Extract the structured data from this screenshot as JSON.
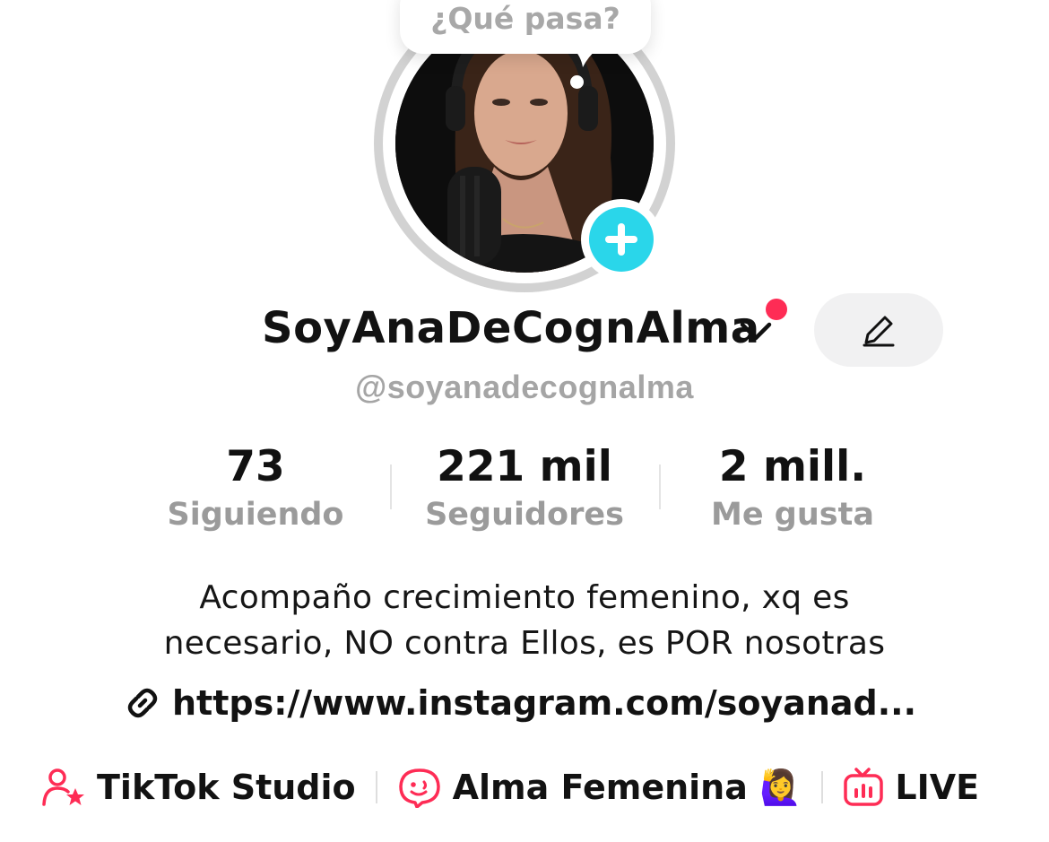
{
  "bubble": {
    "text": "¿Qué pasa?"
  },
  "profile": {
    "display_name": "SoyAnaDeCognAlma",
    "username": "@soyanadecognalma"
  },
  "stats": [
    {
      "value": "73",
      "label": "Siguiendo"
    },
    {
      "value": "221 mil",
      "label": "Seguidores"
    },
    {
      "value": "2 mill.",
      "label": "Me gusta"
    }
  ],
  "bio": {
    "line1": "Acompaño crecimiento femenino, xq es",
    "line2": "necesario, NO contra Ellos, es POR nosotras"
  },
  "link": {
    "text": "https://www.instagram.com/soyanad...",
    "icon": "link-icon"
  },
  "bottom_links": [
    {
      "label": "TikTok Studio",
      "icon": "creator-studio-icon"
    },
    {
      "label": "Alma Femenina 🙋‍♀️",
      "icon": "chat-bubble-face-icon"
    },
    {
      "label": "LIVE",
      "icon": "live-tv-icon"
    }
  ],
  "colors": {
    "accent_cyan": "#2ad6ea",
    "notification_red": "#fe2c55",
    "icon_pink": "#fe2c55",
    "muted_text": "#a5a5a5"
  }
}
